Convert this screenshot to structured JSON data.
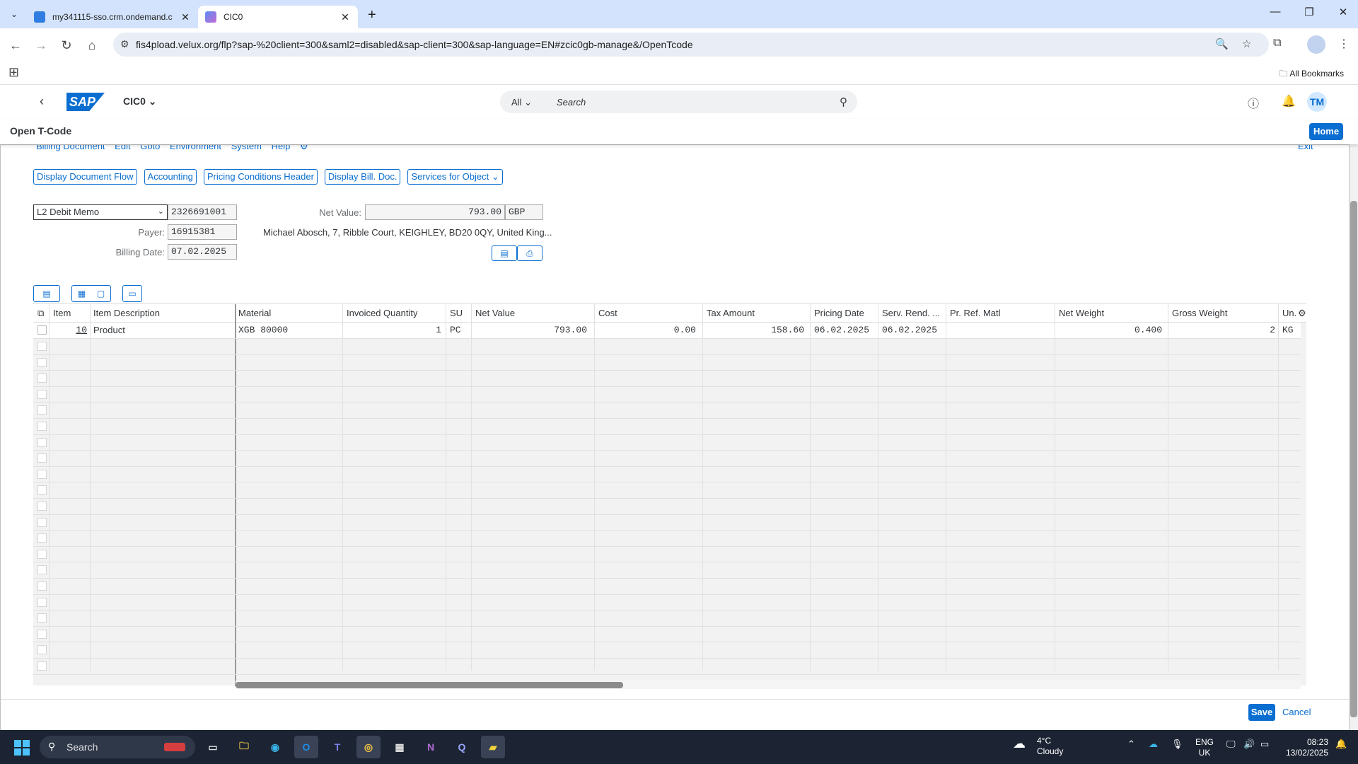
{
  "browser": {
    "tabs": [
      {
        "title": "my341115-sso.crm.ondemand.c",
        "active": false
      },
      {
        "title": "CIC0",
        "active": true
      }
    ],
    "url": "fis4pload.velux.org/flp?sap-%20client=300&saml2=disabled&sap-client=300&sap-language=EN#zcic0gb-manage&/OpenTcode",
    "bookmarks_label": "All Bookmarks"
  },
  "shell": {
    "app_title": "CIC0",
    "search_scope": "All",
    "search_placeholder": "Search",
    "user_initials": "TM",
    "logo_text": "SAP"
  },
  "subheader": {
    "title": "Open T-Code",
    "home_label": "Home"
  },
  "menu": {
    "items": [
      "Billing Document",
      "Edit",
      "Goto",
      "Environment",
      "System",
      "Help"
    ],
    "exit_label": "Exit"
  },
  "actions": {
    "doc_flow": "Display Document Flow",
    "accounting": "Accounting",
    "pricing_header": "Pricing Conditions Header",
    "display_bill_doc": "Display Bill. Doc.",
    "services": "Services for Object"
  },
  "header": {
    "doc_type": "L2 Debit Memo",
    "doc_number": "2326691001",
    "net_value_label": "Net Value:",
    "net_value": "793.00",
    "currency": "GBP",
    "payer_label": "Payer:",
    "payer": "16915381",
    "payer_address": "Michael Abosch, 7, Ribble Court, KEIGHLEY, BD20 0QY, United King...",
    "billing_date_label": "Billing Date:",
    "billing_date": "07.02.2025"
  },
  "table": {
    "columns": [
      "Item",
      "Item Description",
      "Material",
      "Invoiced Quantity",
      "SU",
      "Net Value",
      "Cost",
      "Tax Amount",
      "Pricing Date",
      "Serv. Rend. ...",
      "Pr. Ref. Matl",
      "Net Weight",
      "Gross Weight",
      "Un."
    ],
    "rows": [
      {
        "item": "10",
        "description": "Product",
        "material": "XGB 80000",
        "qty": "1",
        "su": "PC",
        "net_value": "793.00",
        "cost": "0.00",
        "tax": "158.60",
        "pricing_date": "06.02.2025",
        "serv_rend": "06.02.2025",
        "pr_ref": "",
        "net_weight": "0.400",
        "gross_weight": "2",
        "unit": "KG"
      }
    ]
  },
  "footer": {
    "save_label": "Save",
    "cancel_label": "Cancel"
  },
  "taskbar": {
    "search_label": "Search",
    "weather_temp": "4°C",
    "weather_desc": "Cloudy",
    "lang_top": "ENG",
    "lang_bottom": "UK",
    "time": "08:23",
    "date": "13/02/2025"
  }
}
